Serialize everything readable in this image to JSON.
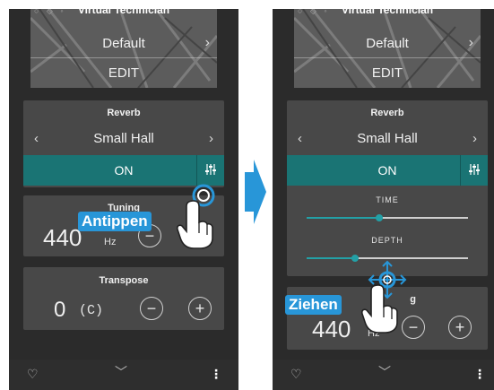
{
  "header": {
    "title": "Virtual Technician",
    "preset": "Default",
    "edit": "EDIT"
  },
  "reverb": {
    "title": "Reverb",
    "value": "Small Hall",
    "state": "ON"
  },
  "tuning": {
    "title": "Tuning",
    "value": "440",
    "unit": "Hz"
  },
  "transpose": {
    "title": "Transpose",
    "value": "0",
    "key": "(C)"
  },
  "sliders": {
    "time_label": "TIME",
    "depth_label": "DEPTH",
    "time_level": 0.45,
    "depth_level": 0.3
  },
  "annotations": {
    "tap": "Antippen",
    "drag": "Ziehen"
  },
  "glyphs": {
    "left": "‹",
    "right": "›",
    "minus": "−",
    "plus": "+",
    "heart": "♡",
    "down": "﹀",
    "menu": "⋮"
  },
  "colors": {
    "accent": "#1a7474",
    "callout": "#2896d8",
    "slider": "#23a0a6"
  },
  "icons": [
    "equalizer-icon",
    "heart-icon",
    "chevron-down-icon",
    "menu-icon",
    "hand-icon",
    "arrow-right-icon"
  ]
}
